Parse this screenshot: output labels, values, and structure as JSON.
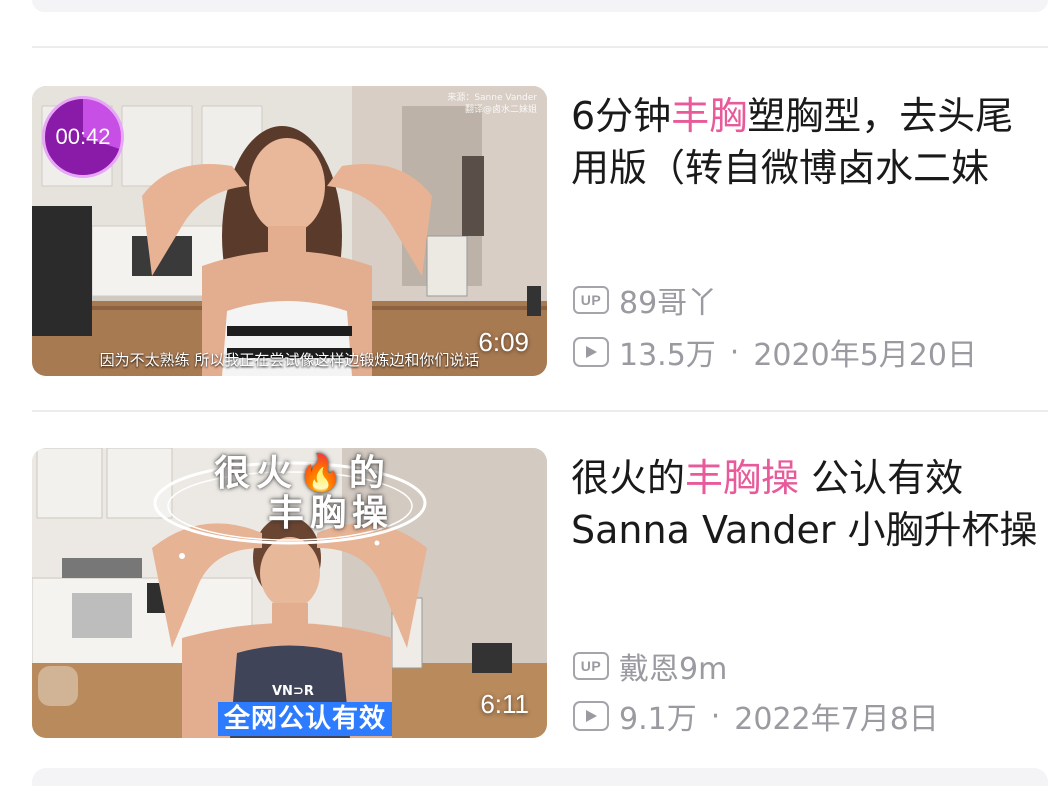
{
  "videos": [
    {
      "title_parts": [
        "6分钟",
        "丰胸",
        "塑胸型，去头尾"
      ],
      "title_line2": "用版（转自微博卤水二妹",
      "author": "89哥丫",
      "views": "13.5万",
      "date": "2020年5月20日",
      "duration": "6:09",
      "timer": "00:42",
      "source_tag": [
        "来源：Sanne Vander",
        "翻译@卤水二妹姐"
      ],
      "subtitle": "因为不太熟练  所以我正在尝试像这样边锻炼边和你们说话"
    },
    {
      "title_parts": [
        "很火的",
        "丰胸操",
        " 公认有效"
      ],
      "title_line2": "Sanna Vander 小胸升杯操",
      "author": "戴恩9m",
      "views": "9.1万",
      "date": "2022年7月8日",
      "duration": "6:11",
      "overlay_line1": "很火🔥的",
      "overlay_line2": "丰胸操",
      "overlay_banner": "全网公认有效",
      "shirt_logo": "VN⊃R"
    }
  ],
  "labels": {
    "up_badge": "UP",
    "separator": "·"
  },
  "colors": {
    "highlight": "#e85a9a",
    "meta": "#9a9aa0",
    "title": "#1a1a1a",
    "timer": "#8a1aa8",
    "banner": "#2d7bff"
  }
}
